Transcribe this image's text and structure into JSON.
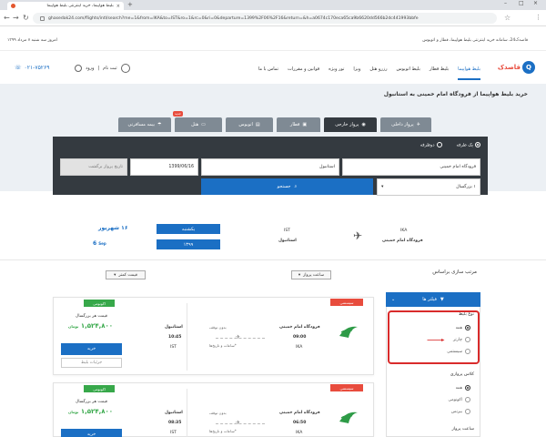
{
  "browser": {
    "tab_title": "بلیط هواپیما، خرید اینترنتی بلیط هواپیما",
    "url": "ghasedak24.com/flights/intl/search?me=1&from=IKA&to=IST&ro=1&rc=0&ri=0&departure=1399%2F06%2F16&return=&h=a0674c170eca65ca9b6620dd566b2dc441993bbfe"
  },
  "infobar": {
    "right_text": "قاصدک24، سامانه خرید اینترنتی بلیط هواپیما، قطار و اتوبوس",
    "left_text": "امروز سه شنبه ۷ مرداد ۱۳۹۹"
  },
  "header": {
    "logo_text": "قاصدک",
    "nav": [
      "بلیط هواپیما",
      "بلیط قطار",
      "بلیط اتوبوس",
      "رزرو هتل",
      "ویزا",
      "تور ویژه",
      "قوانین و مقررات",
      "تماس با ما"
    ],
    "login_label": "ورود",
    "signup_label": "ثبت نام",
    "phone": "۰۲۱-۷۵۲۶۹"
  },
  "hero": {
    "title": "خرید بلیط هواپیما از فرودگاه امام خمینی به استانبول",
    "tabs": [
      {
        "label": "پرواز داخلی",
        "active": false
      },
      {
        "label": "پرواز خارجی",
        "active": true
      },
      {
        "label": "قطار",
        "active": false
      },
      {
        "label": "اتوبوس",
        "active": false
      },
      {
        "label": "هتل",
        "active": false,
        "badge": "جدید"
      },
      {
        "label": "بیمه مسافرتی",
        "active": false
      }
    ],
    "trip_one_way": "یک طرفه",
    "trip_round": "دوطرفه",
    "origin": "فرودگاه امام خمینی",
    "destination": "استانبول",
    "depart_date": "1399/06/16",
    "return_date_placeholder": "تاریخ پرواز برگشت",
    "passengers": "۱ بزرگسال",
    "search_label": "جستجو"
  },
  "summary": {
    "from_code": "IKA",
    "from_name": "فرودگاه امام خمینی",
    "to_code": "IST",
    "to_name": "استانبول",
    "day_name": "یکشنبه",
    "year": "۱۳۹۹",
    "day_number": "۱۶",
    "month": "شهریور",
    "weekday_en_num": "6",
    "month_en": "Sep"
  },
  "sort": {
    "title": "مرتب سازی براساس",
    "by_time": "ساعت پرواز",
    "by_price": "قیمت کمتر"
  },
  "filters": {
    "button_label": "فیلتر ها",
    "ticket_type_title": "نوع بلیط",
    "ticket_types": [
      "همه",
      "چارتر",
      "سیستمی"
    ],
    "class_title": "کلاس پروازی",
    "classes": [
      "همه",
      "اکونومی",
      "بیزنس"
    ],
    "time_title": "ساعت پرواز"
  },
  "flights": [
    {
      "badge": "سیستمی",
      "class_badge": "اکونومی",
      "origin_name": "فرودگاه امام خمینی",
      "origin_time": "09:00",
      "origin_code": "IKA",
      "dest_name": "استانبول",
      "dest_time": "10:45",
      "dest_code": "IST",
      "stops": "بدون توقف",
      "baggage": "*ساعات و تاریخ‌ها",
      "price_label": "قیمت هر بزرگسال",
      "price": "۱,۵۲۴,۸۰۰",
      "currency": "تومان",
      "buy_label": "خرید",
      "details_label": "جزئیات بلیط"
    },
    {
      "badge": "سیستمی",
      "class_badge": "اکونومی",
      "origin_name": "فرودگاه امام خمینی",
      "origin_time": "06:50",
      "origin_code": "IKA",
      "dest_name": "استانبول",
      "dest_time": "08:35",
      "dest_code": "IST",
      "stops": "بدون توقف",
      "baggage": "*ساعات و تاریخ‌ها",
      "price_label": "قیمت هر بزرگسال",
      "price": "۱,۵۲۴,۸۰۰",
      "currency": "تومان",
      "buy_label": "خرید",
      "details_label": "جزئیات بلیط"
    }
  ],
  "colors": {
    "primary": "#1b6fc4",
    "accent": "#e84c3d",
    "green": "#37a84a",
    "panel": "#343a40"
  }
}
